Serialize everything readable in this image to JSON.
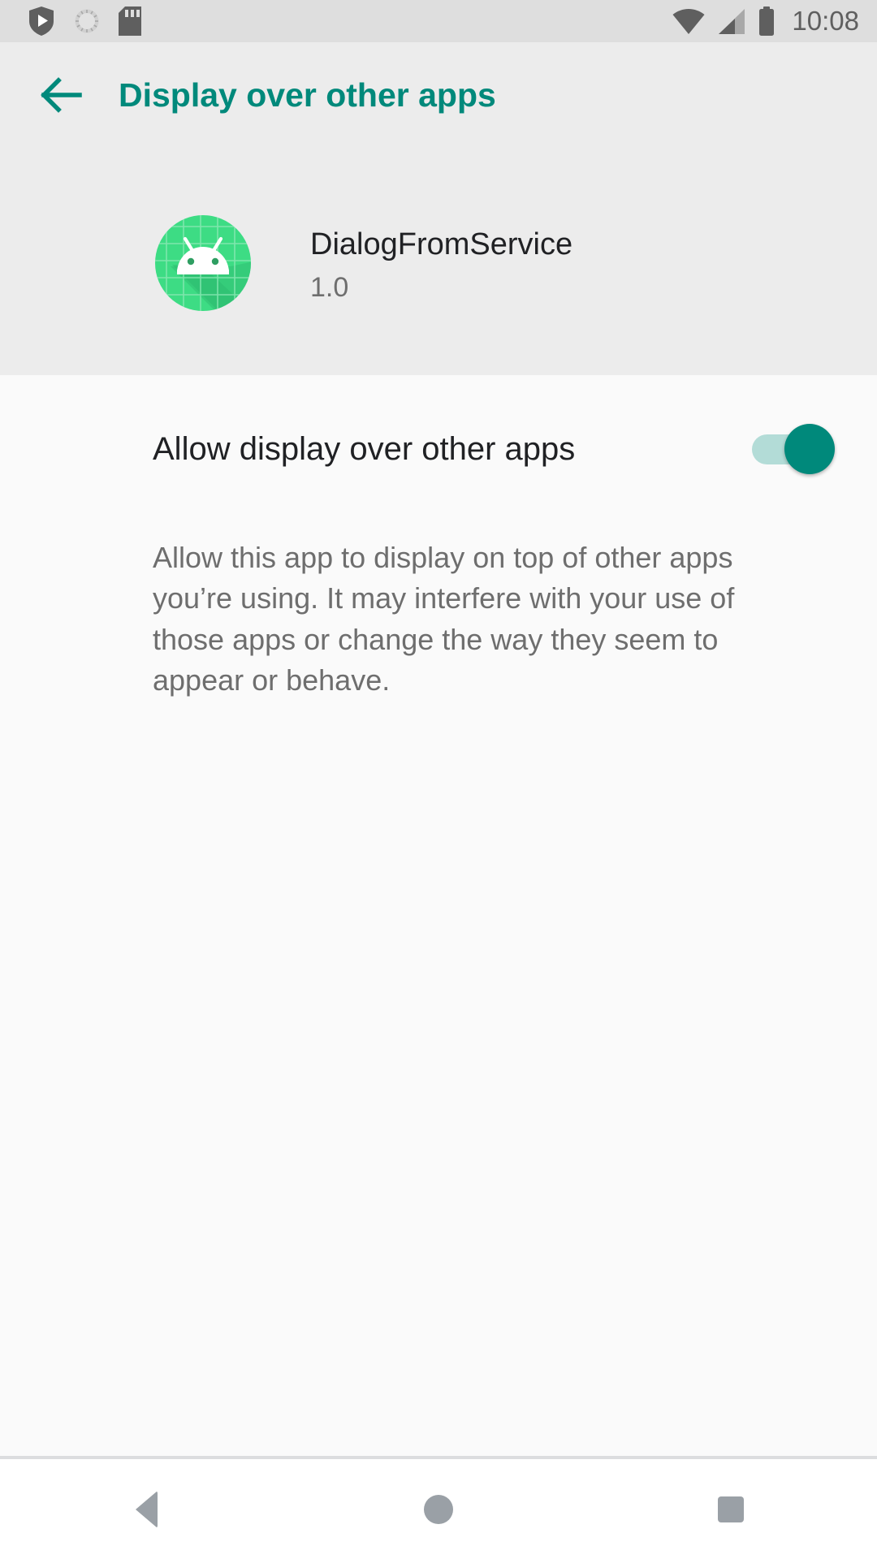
{
  "status_bar": {
    "icons_left": [
      {
        "name": "play-protect-icon",
        "label": "Play Protect"
      },
      {
        "name": "rotation-dial-icon",
        "label": "Screen rotation"
      },
      {
        "name": "sd-card-icon",
        "label": "SD card"
      }
    ],
    "icons_right": [
      {
        "name": "wifi-icon",
        "label": "Wi-Fi full signal"
      },
      {
        "name": "cell-signal-icon",
        "label": "Mobile signal"
      },
      {
        "name": "battery-icon",
        "label": "Battery full"
      }
    ],
    "clock": "10:08",
    "background_color": "#dedede",
    "icon_color": "#5f5f5f"
  },
  "app_bar": {
    "back_label": "Navigate up",
    "title": "Display over other apps",
    "accent_color": "#00897b",
    "background_color": "#ececec"
  },
  "app_info": {
    "icon_name": "android-app-icon",
    "app_name": "DialogFromService",
    "version": "1.0",
    "icon_colors": {
      "circle": "#3ddc84",
      "robot": "#ffffff",
      "shadow": "#2bb86c",
      "grid": "#8ae8b4"
    }
  },
  "setting": {
    "label": "Allow display over other apps",
    "switch_state": "on",
    "switch_track_color": "#b3dcd7",
    "switch_thumb_color": "#00897b",
    "description": "Allow this app to display on top of other apps you’re using. It may interfere with your use of those apps or change the way they seem to appear or behave."
  },
  "nav_bar": {
    "buttons": [
      {
        "name": "nav-back-button",
        "label": "Back"
      },
      {
        "name": "nav-home-button",
        "label": "Home"
      },
      {
        "name": "nav-recents-button",
        "label": "Recents"
      }
    ],
    "glyph_color": "#9aa0a6",
    "background_color": "#ffffff"
  }
}
